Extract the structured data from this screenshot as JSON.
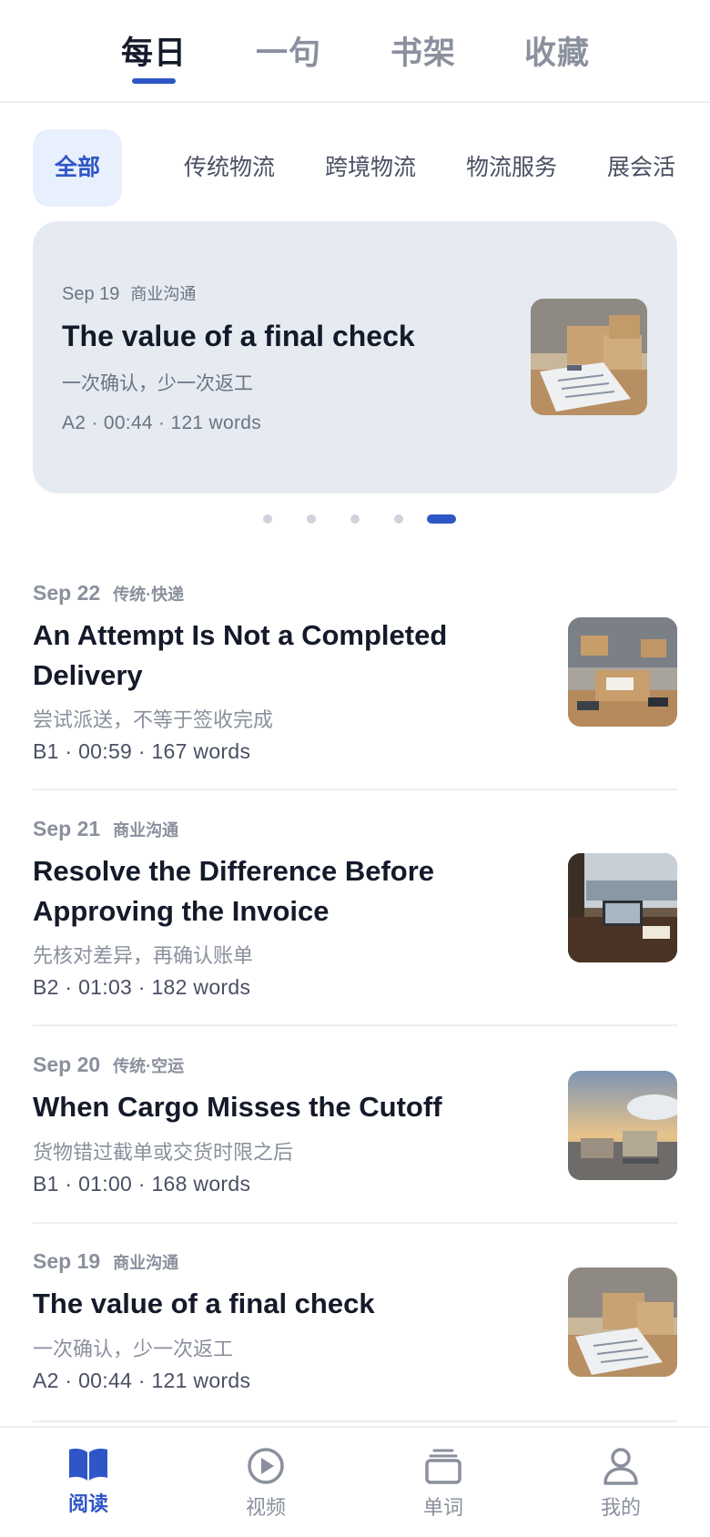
{
  "top_tabs": [
    {
      "label": "每日",
      "active": true
    },
    {
      "label": "一句",
      "active": false
    },
    {
      "label": "书架",
      "active": false
    },
    {
      "label": "收藏",
      "active": false
    }
  ],
  "categories": [
    {
      "label": "全部",
      "active": true
    },
    {
      "label": "传统物流",
      "active": false
    },
    {
      "label": "跨境物流",
      "active": false
    },
    {
      "label": "物流服务",
      "active": false
    },
    {
      "label": "展会活动",
      "active": false
    }
  ],
  "featured": {
    "date": "Sep 19",
    "category": "商业沟通",
    "title": "The value of a final check",
    "subtitle": "一次确认，少一次返工",
    "info": "A2 · 00:44 · 121 words",
    "image": "clipboard-boxes-photo"
  },
  "carousel": {
    "count": 5,
    "active_index": 4
  },
  "articles": [
    {
      "date": "Sep 22",
      "category": "传统·快递",
      "title": "An Attempt Is Not a Completed Delivery",
      "subtitle": "尝试派送，不等于签收完成",
      "info": "B1 · 00:59 · 167 words",
      "image": "parcel-warehouse-photo"
    },
    {
      "date": "Sep 21",
      "category": "商业沟通",
      "title": "Resolve the Difference Before Approving the Invoice",
      "subtitle": "先核对差异，再确认账单",
      "info": "B2 · 01:03 · 182 words",
      "image": "port-office-desk-photo"
    },
    {
      "date": "Sep 20",
      "category": "传统·空运",
      "title": "When Cargo Misses the Cutoff",
      "subtitle": "货物错过截单或交货时限之后",
      "info": "B1 · 01:00 · 168 words",
      "image": "airport-cargo-photo"
    },
    {
      "date": "Sep 19",
      "category": "商业沟通",
      "title": "The value of a final check",
      "subtitle": "一次确认，少一次返工",
      "info": "A2 · 00:44 · 121 words",
      "image": "clipboard-boxes-photo"
    }
  ],
  "bottom_nav": [
    {
      "label": "阅读",
      "icon": "book-icon",
      "active": true
    },
    {
      "label": "视频",
      "icon": "play-icon",
      "active": false
    },
    {
      "label": "单词",
      "icon": "cards-icon",
      "active": false
    },
    {
      "label": "我的",
      "icon": "user-icon",
      "active": false
    }
  ],
  "colors": {
    "accent": "#2f56c6",
    "chip_active_bg": "#e9f0fd",
    "card_bg": "#e6ebf2"
  }
}
